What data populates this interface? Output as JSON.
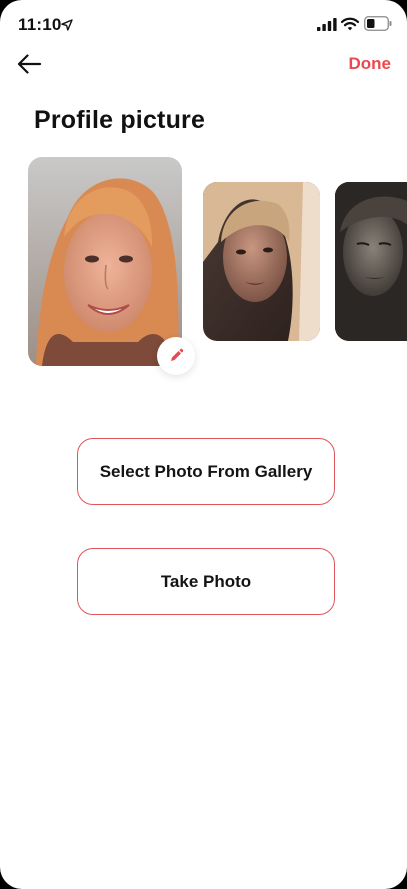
{
  "status_bar": {
    "time": "11:10",
    "icons": [
      "location-arrow-icon",
      "signal-icon",
      "wifi-icon",
      "battery-icon"
    ]
  },
  "nav": {
    "back_icon": "arrow-left-icon",
    "done_label": "Done"
  },
  "page": {
    "title": "Profile picture"
  },
  "photos": {
    "items": [
      "photo-1",
      "photo-2",
      "photo-3"
    ],
    "edit_icon": "pencil-icon"
  },
  "actions": {
    "select_gallery_label": "Select Photo From Gallery",
    "take_photo_label": "Take Photo"
  },
  "colors": {
    "accent": "#e94a52",
    "button_border": "#e0555c",
    "text": "#111111",
    "background": "#ffffff"
  }
}
